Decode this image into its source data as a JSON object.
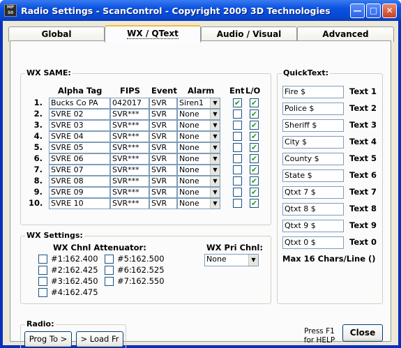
{
  "window": {
    "title": "Radio Settings - ScanControl - Copyright 2009 3D Technologies",
    "icon_text": "MP\n50",
    "minimize": "—",
    "maximize": "□",
    "close": "✕"
  },
  "tabs": [
    "Global",
    "WX / QText",
    "Audio / Visual",
    "Advanced"
  ],
  "active_tab": "WX / QText",
  "wx_same": {
    "label": "WX SAME:",
    "headers": {
      "alpha": "Alpha Tag",
      "fips": "FIPS",
      "event": "Event",
      "alarm": "Alarm",
      "ent": "Ent",
      "lo": "L/O"
    },
    "rows": [
      {
        "num": "1.",
        "alpha": "Bucks Co PA",
        "fips": "042017",
        "event": "SVR",
        "alarm": "Siren1",
        "ent": "✔",
        "lo": "✔"
      },
      {
        "num": "2.",
        "alpha": "SVRE 02",
        "fips": "SVR***",
        "event": "SVR",
        "alarm": "None",
        "ent": "",
        "lo": "✔"
      },
      {
        "num": "3.",
        "alpha": "SVRE 03",
        "fips": "SVR***",
        "event": "SVR",
        "alarm": "None",
        "ent": "",
        "lo": "✔"
      },
      {
        "num": "4.",
        "alpha": "SVRE 04",
        "fips": "SVR***",
        "event": "SVR",
        "alarm": "None",
        "ent": "",
        "lo": "✔"
      },
      {
        "num": "5.",
        "alpha": "SVRE 05",
        "fips": "SVR***",
        "event": "SVR",
        "alarm": "None",
        "ent": "",
        "lo": "✔"
      },
      {
        "num": "6.",
        "alpha": "SVRE 06",
        "fips": "SVR***",
        "event": "SVR",
        "alarm": "None",
        "ent": "",
        "lo": "✔"
      },
      {
        "num": "7.",
        "alpha": "SVRE 07",
        "fips": "SVR***",
        "event": "SVR",
        "alarm": "None",
        "ent": "",
        "lo": "✔"
      },
      {
        "num": "8.",
        "alpha": "SVRE 08",
        "fips": "SVR***",
        "event": "SVR",
        "alarm": "None",
        "ent": "",
        "lo": "✔"
      },
      {
        "num": "9.",
        "alpha": "SVRE 09",
        "fips": "SVR***",
        "event": "SVR",
        "alarm": "None",
        "ent": "",
        "lo": "✔"
      },
      {
        "num": "10.",
        "alpha": "SVRE 10",
        "fips": "SVR***",
        "event": "SVR",
        "alarm": "None",
        "ent": "",
        "lo": "✔"
      }
    ]
  },
  "wx_settings": {
    "label": "WX Settings:",
    "attenuator_label": "WX Chnl Attenuator:",
    "channels": [
      {
        "label": "#1:",
        "freq": "162.400"
      },
      {
        "label": "#2:",
        "freq": "162.425"
      },
      {
        "label": "#3:",
        "freq": "162.450"
      },
      {
        "label": "#4:",
        "freq": "162.475"
      },
      {
        "label": "#5:",
        "freq": "162.500"
      },
      {
        "label": "#6:",
        "freq": "162.525"
      },
      {
        "label": "#7:",
        "freq": "162.550"
      }
    ],
    "pri_label": "WX Pri Chnl:",
    "pri_value": "None"
  },
  "quicktext": {
    "label": "QuickText:",
    "items": [
      {
        "value": "Fire $",
        "label": "Text 1"
      },
      {
        "value": "Police $",
        "label": "Text 2"
      },
      {
        "value": "Sheriff $",
        "label": "Text 3"
      },
      {
        "value": "City $",
        "label": "Text 4"
      },
      {
        "value": "County $",
        "label": "Text 5"
      },
      {
        "value": "State $",
        "label": "Text 6"
      },
      {
        "value": "Qtxt 7 $",
        "label": "Text 7"
      },
      {
        "value": "Qtxt 8 $",
        "label": "Text 8"
      },
      {
        "value": "Qtxt 9 $",
        "label": "Text 9"
      },
      {
        "value": "Qtxt 0 $",
        "label": "Text 0"
      }
    ],
    "max_note": "Max 16 Chars/Line ()"
  },
  "radio": {
    "label": "Radio:",
    "prog_to": "Prog To >",
    "load_fr": "> Load Fr"
  },
  "help": {
    "line1": "Press F1",
    "line2": "for HELP"
  },
  "close_label": "Close"
}
